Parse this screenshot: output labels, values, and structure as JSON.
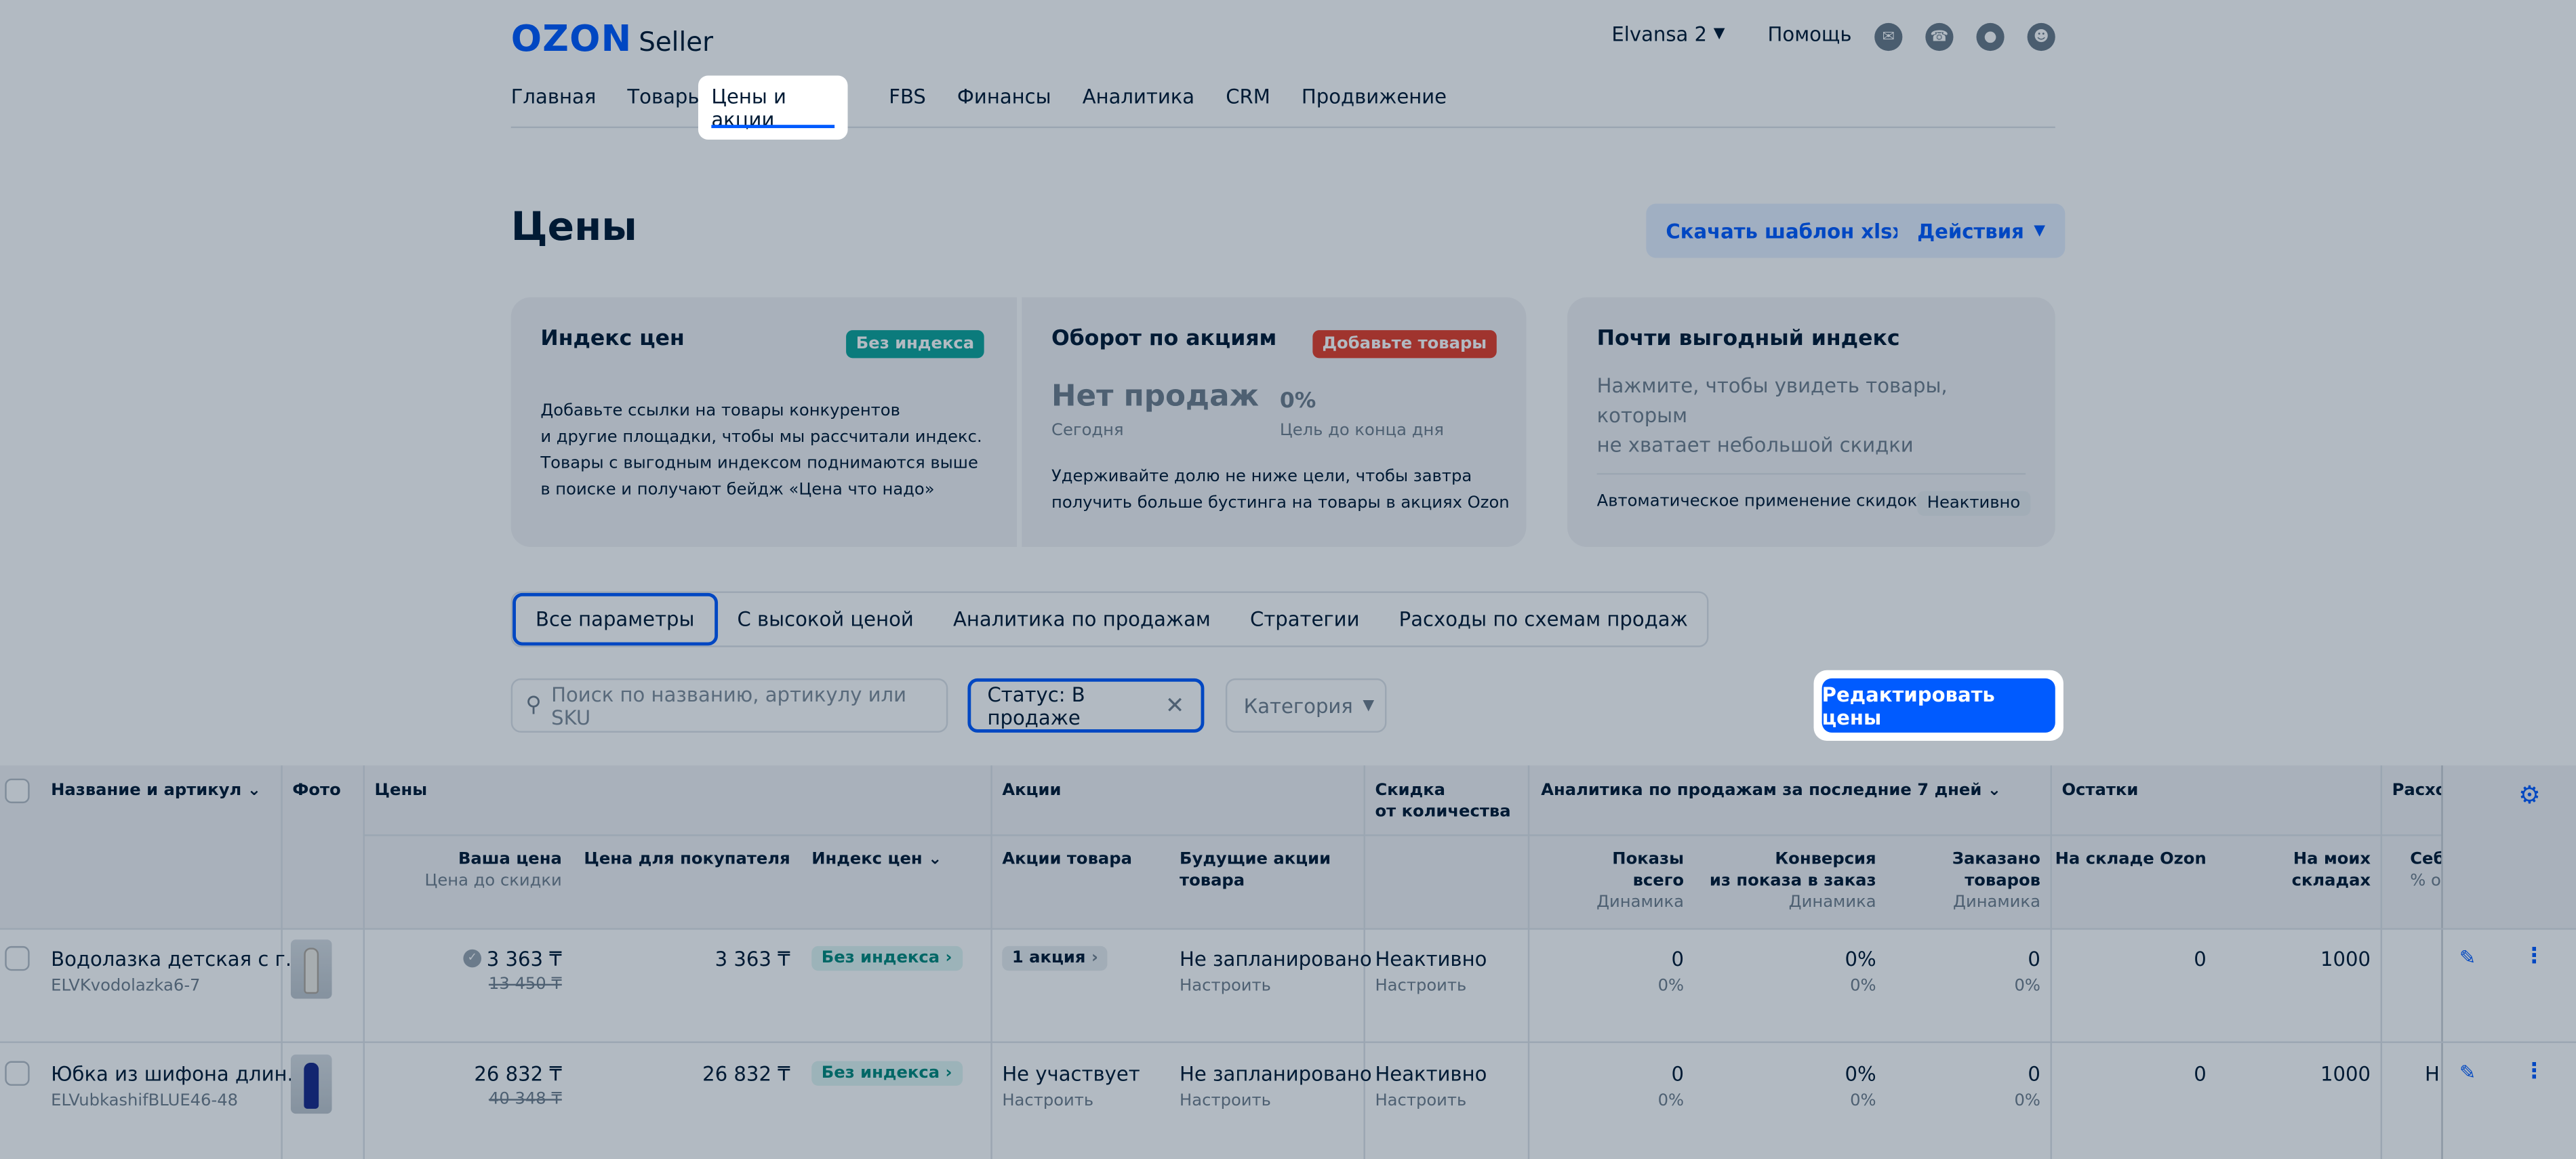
{
  "header": {
    "logo_ozon": "OZON",
    "logo_seller": "Seller",
    "account": "Elvansa 2",
    "help": "Помощь",
    "icons": [
      "chat-icon",
      "headset-icon",
      "bell-icon",
      "user-icon"
    ]
  },
  "nav": {
    "tabs": [
      "Главная",
      "Товары",
      "Цены и акции",
      "FBS",
      "Финансы",
      "Аналитика",
      "CRM",
      "Продвижение"
    ],
    "active": "Цены и акции"
  },
  "page": {
    "title": "Цены",
    "download_btn": "Скачать шаблон xlsx",
    "actions_btn": "Действия"
  },
  "cards": {
    "index": {
      "title": "Индекс цен",
      "badge": "Без индекса",
      "text": [
        "Добавьте ссылки на товары конкурентов",
        "и другие площадки, чтобы мы рассчитали индекс.",
        "Товары с выгодным индексом поднимаются выше",
        "в поиске и получают бейдж «Цена что надо»"
      ]
    },
    "turnover": {
      "title": "Оборот по акциям",
      "badge": "Добавьте товары",
      "value": "Нет продаж",
      "value_label": "Сегодня",
      "pct": "0%",
      "pct_label": "Цель до конца дня",
      "text": [
        "Удерживайте долю не ниже цели, чтобы завтра",
        "получить больше бустинга на товары в акциях Ozon"
      ]
    },
    "almost": {
      "title": "Почти выгодный индекс",
      "text": [
        "Нажмите, чтобы увидеть товары, которым",
        "не хватает небольшой скидки"
      ],
      "auto_label": "Автоматическое применение скидок",
      "auto_status": "Неактивно"
    }
  },
  "segments": [
    "Все параметры",
    "С высокой ценой",
    "Аналитика по продажам",
    "Стратегии",
    "Расходы по схемам продаж"
  ],
  "filters": {
    "search_placeholder": "Поиск по названию, артикулу или SKU",
    "status_chip": "Статус: В продаже",
    "category": "Категория",
    "edit_prices": "Редактировать цены"
  },
  "table": {
    "h_name": "Название и артикул",
    "h_photo": "Фото",
    "h_prices": "Цены",
    "h_your_price": "Ваша цена",
    "h_before_discount": "Цена до скидки",
    "h_buyer_price": "Цена для покупателя",
    "h_price_index": "Индекс цен",
    "h_promos": "Акции",
    "h_product_promos": "Акции товара",
    "h_future_promos_1": "Будущие акции",
    "h_future_promos_2": "товара",
    "h_qty_discount_1": "Скидка",
    "h_qty_discount_2": "от количества",
    "h_analytics": "Аналитика по продажам за последние 7 дней",
    "h_views_1": "Показы",
    "h_views_2": "всего",
    "h_dynamics": "Динамика",
    "h_conv_1": "Конверсия",
    "h_conv_2": "из показа в заказ",
    "h_ordered_1": "Заказано",
    "h_ordered_2": "товаров",
    "h_stock": "Остатки",
    "h_ozon_wh": "На складе Ozon",
    "h_my_wh": "На моих складах",
    "h_expenses": "Расхо",
    "h_cost_1": "Себ",
    "h_cost_2": "% от",
    "rows": [
      {
        "name": "Водолазка детская с г...",
        "sku": "ELVKvodolazka6-7",
        "price": "3 363 ₸",
        "old_price": "13 450 ₸",
        "buyer_price": "3 363 ₸",
        "index": "Без индекса",
        "promo": "1 акция",
        "promo_sub": "",
        "future": "Не запланировано",
        "future_sub": "Настроить",
        "qty": "Неактивно",
        "qty_sub": "Настроить",
        "views": "0",
        "views_dyn": "0%",
        "conv": "0%",
        "conv_dyn": "0%",
        "ordered": "0",
        "ordered_dyn": "0%",
        "ozon_wh": "0",
        "my_wh": "1000",
        "cost": ""
      },
      {
        "name": "Юбка из шифона длин...",
        "sku": "ELVubkashifBLUE46-48",
        "price": "26 832 ₸",
        "old_price": "40 348 ₸",
        "buyer_price": "26 832 ₸",
        "index": "Без индекса",
        "promo": "Не участвует",
        "promo_sub": "Настроить",
        "future": "Не запланировано",
        "future_sub": "Настроить",
        "qty": "Неактивно",
        "qty_sub": "Настроить",
        "views": "0",
        "views_dyn": "0%",
        "conv": "0%",
        "conv_dyn": "0%",
        "ordered": "0",
        "ordered_dyn": "0%",
        "ozon_wh": "0",
        "my_wh": "1000",
        "cost": "Н"
      }
    ]
  },
  "colors": {
    "accent": "#005bff",
    "badge_teal": "#10a59b",
    "badge_red": "#e5402b"
  }
}
